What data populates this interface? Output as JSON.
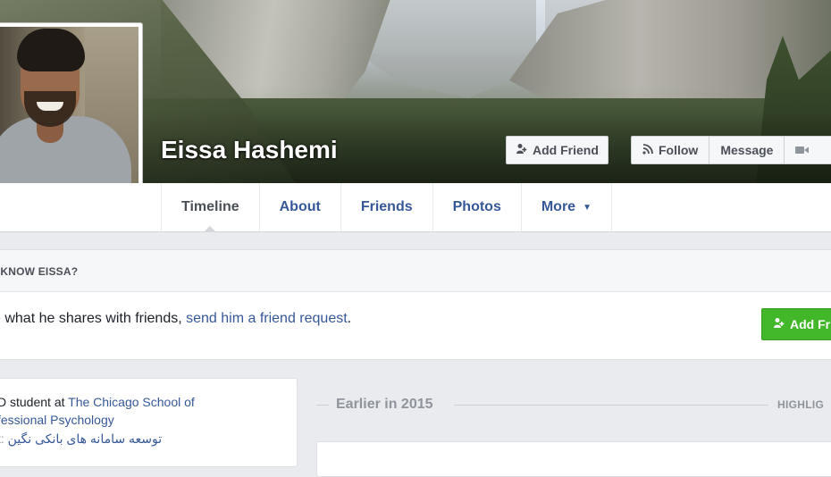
{
  "profile": {
    "name": "Eissa Hashemi"
  },
  "cover_actions": {
    "add_friend_label": "Add Friend",
    "follow_label": "Follow",
    "message_label": "Message"
  },
  "icons": {
    "add_friend": "add-person-icon",
    "follow": "rss-icon",
    "video": "video-camera-icon",
    "dropdown": "caret-down-icon"
  },
  "tabs": [
    {
      "label": "Timeline",
      "active": true
    },
    {
      "label": "About"
    },
    {
      "label": "Friends"
    },
    {
      "label": "Photos"
    },
    {
      "label": "More"
    }
  ],
  "know_card": {
    "title": "U KNOW EISSA?",
    "text_before": "e what he shares with friends, ",
    "link_text": "send him a friend request",
    "text_after": ".",
    "button_label": "Add Fr"
  },
  "intro": {
    "line1_prefix": "D student at ",
    "line1_link": "The Chicago School of",
    "line2_link": "fessional Psychology",
    "line3_prefix": "t: ",
    "line3_link": "توسعه سامانه های بانکی نگین"
  },
  "timeline": {
    "section_label": "Earlier in 2015",
    "highlights_label": "HIGHLIG"
  },
  "colors": {
    "link": "#365899",
    "green_button": "#42b72a",
    "page_bg": "#e9ebee"
  }
}
